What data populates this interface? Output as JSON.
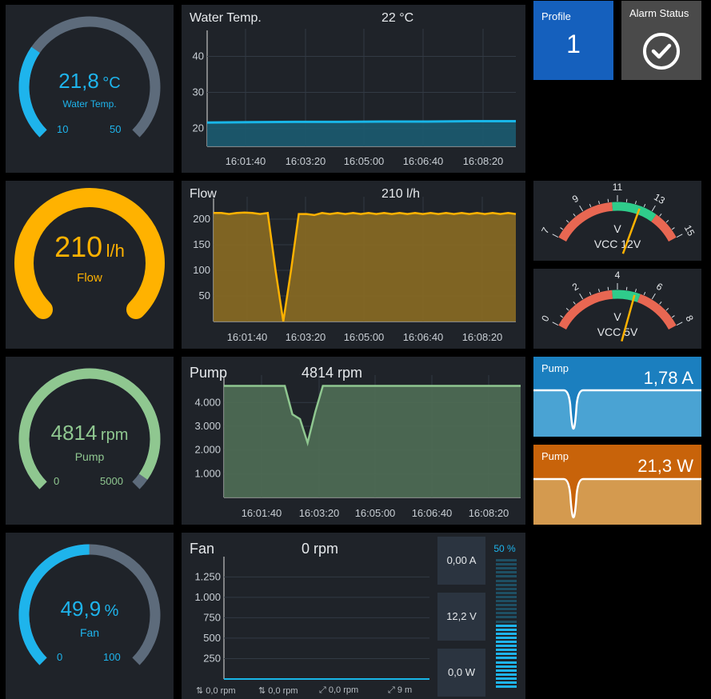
{
  "gauges": {
    "water": {
      "value": "21,8",
      "unit": "°C",
      "label": "Water Temp.",
      "min": "10",
      "max": "50",
      "fraction": 0.295,
      "color": "#1eb4ec"
    },
    "flow": {
      "value": "210",
      "unit": "l/h",
      "label": "Flow",
      "fraction": 1.0,
      "color": "#ffb200"
    },
    "pump": {
      "value": "4814",
      "unit": "rpm",
      "label": "Pump",
      "min": "0",
      "max": "5000",
      "fraction": 0.963,
      "color": "#8fc790"
    },
    "fan": {
      "value": "49,9",
      "unit": "%",
      "label": "Fan",
      "min": "0",
      "max": "100",
      "fraction": 0.499,
      "color": "#1eb4ec"
    }
  },
  "charts": {
    "water": {
      "title": "Water Temp.",
      "current": "22 °C"
    },
    "flow": {
      "title": "Flow",
      "current": "210 l/h"
    },
    "pump": {
      "title": "Pump",
      "current": "4814 rpm"
    },
    "fan": {
      "title": "Fan",
      "current": "0 rpm"
    }
  },
  "chart_data": [
    {
      "type": "area",
      "title": "Water Temp.",
      "x": [
        "16:01:40",
        "16:03:20",
        "16:05:00",
        "16:06:40",
        "16:08:20"
      ],
      "yticks": [
        "20",
        "30",
        "40"
      ],
      "ylim": [
        15,
        45
      ],
      "series": [
        {
          "values": [
            21.6,
            21.7,
            21.8,
            21.8,
            21.9,
            21.9,
            22.0,
            22.0
          ]
        }
      ],
      "color": "#18b6e8"
    },
    {
      "type": "area",
      "title": "Flow",
      "x": [
        "16:01:40",
        "16:03:20",
        "16:05:00",
        "16:06:40",
        "16:08:20"
      ],
      "yticks": [
        "50",
        "100",
        "150",
        "200"
      ],
      "ylim": [
        0,
        225
      ],
      "series": [
        {
          "values": [
            212,
            212,
            210,
            212,
            213,
            212,
            210,
            212,
            100,
            0,
            100,
            210,
            210,
            208,
            212,
            210,
            212,
            210,
            212,
            210,
            212,
            210,
            212,
            210,
            212,
            210,
            212,
            210,
            212,
            210,
            212,
            210,
            212,
            210,
            212,
            210,
            212,
            210,
            212,
            210
          ]
        }
      ],
      "color": "#ffb200"
    },
    {
      "type": "area",
      "title": "Pump",
      "x": [
        "16:01:40",
        "16:03:20",
        "16:05:00",
        "16:06:40",
        "16:08:20"
      ],
      "yticks": [
        "1.000",
        "2.000",
        "3.000",
        "4.000"
      ],
      "ylim": [
        0,
        4750
      ],
      "series": [
        {
          "values": [
            4700,
            4700,
            4700,
            4700,
            4700,
            4700,
            4700,
            4700,
            4700,
            3500,
            3300,
            2300,
            3600,
            4700,
            4700,
            4700,
            4700,
            4700,
            4700,
            4700,
            4700,
            4700,
            4700,
            4700,
            4700,
            4700,
            4700,
            4700,
            4700,
            4700,
            4700,
            4700,
            4700,
            4700,
            4700,
            4700,
            4700,
            4700,
            4700,
            4700
          ]
        }
      ],
      "color": "#8fc790"
    },
    {
      "type": "line",
      "title": "Fan",
      "yticks": [
        "250",
        "500",
        "750",
        "1.000",
        "1.250"
      ],
      "ylim": [
        0,
        1400
      ],
      "series": [
        {
          "values": [
            0,
            0,
            0,
            0,
            0,
            0,
            0,
            0,
            0,
            0
          ]
        }
      ],
      "legend": [
        "0,0 rpm",
        "0,0 rpm",
        "0,0 rpm",
        "9 m"
      ],
      "color": "#18b6e8"
    }
  ],
  "tiles": {
    "profile": {
      "title": "Profile",
      "value": "1",
      "color": "#1560bd"
    },
    "alarm": {
      "title": "Alarm Status",
      "color": "#4a4a4a"
    }
  },
  "voltmeters": {
    "vcc12": {
      "labels": [
        "7",
        "9",
        "11",
        "13",
        "15"
      ],
      "unit": "V",
      "name": "VCC 12V",
      "value": 12.3
    },
    "vcc5": {
      "labels": [
        "0",
        "2",
        "4",
        "6",
        "8"
      ],
      "unit": "V",
      "name": "VCC 5V",
      "value": 5.0
    }
  },
  "mini": {
    "current": {
      "title": "Pump",
      "value": "1,78 A",
      "color": "#1b7fbf",
      "fill": "#4aa3d3"
    },
    "power": {
      "title": "Pump",
      "value": "21,3 W",
      "color": "#c8630a",
      "fill": "#d49a4f"
    }
  },
  "fan_stats": {
    "current": "0,00 A",
    "voltage": "12,2 V",
    "power": "0,0 W",
    "percent": "50 %",
    "level": 0.5
  }
}
